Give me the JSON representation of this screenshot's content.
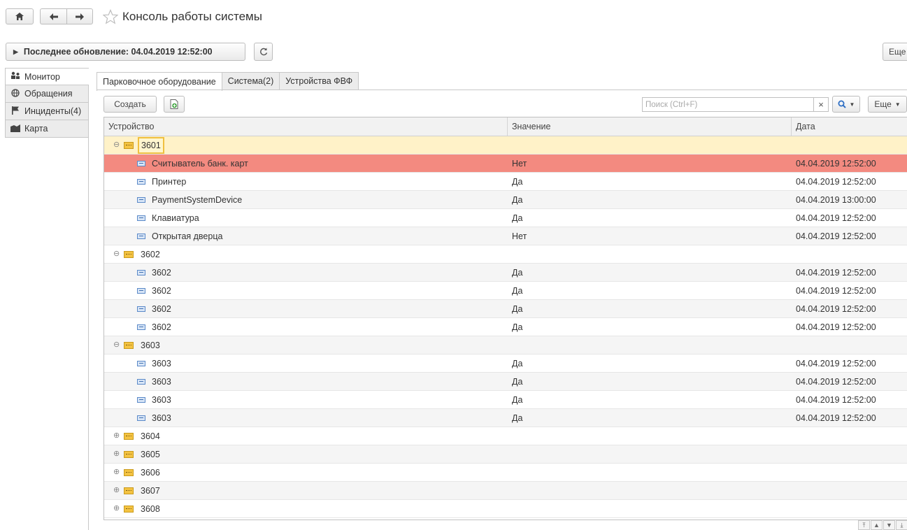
{
  "header": {
    "title": "Консоль работы системы",
    "home_icon": "home-icon",
    "back_icon": "arrow-left-icon",
    "forward_icon": "arrow-right-icon",
    "star_icon": "star-outline-icon"
  },
  "toolbar": {
    "update_label": "Последнее обновление: 04.04.2019 12:52:00",
    "refresh_icon": "refresh-icon",
    "more_label": "Еще"
  },
  "sidebar": {
    "items": [
      {
        "label": "Монитор",
        "icon": "monitor-icon"
      },
      {
        "label": "Обращения",
        "icon": "globe-icon"
      },
      {
        "label": "Инциденты(4)",
        "icon": "flag-icon"
      },
      {
        "label": "Карта",
        "icon": "map-icon"
      }
    ]
  },
  "tabs": [
    "Парковочное оборудование",
    "Система(2)",
    "Устройства ФВФ"
  ],
  "list_toolbar": {
    "create_label": "Создать",
    "add_icon": "add-document-icon",
    "search_placeholder": "Поиск (Ctrl+F)",
    "clear_label": "×",
    "search_icon": "search-icon",
    "more_label": "Еще"
  },
  "grid": {
    "columns": [
      "Устройство",
      "Значение",
      "Дата"
    ],
    "rows": [
      {
        "type": "group",
        "name": "3601",
        "expanded": true,
        "state": "selected"
      },
      {
        "type": "device",
        "name": "Считыватель банк. карт",
        "value": "Нет",
        "date": "04.04.2019 12:52:00",
        "state": "error"
      },
      {
        "type": "device",
        "name": "Принтер",
        "value": "Да",
        "date": "04.04.2019 12:52:00"
      },
      {
        "type": "device",
        "name": "PaymentSystemDevice",
        "value": "Да",
        "date": "04.04.2019 13:00:00"
      },
      {
        "type": "device",
        "name": "Клавиатура",
        "value": "Да",
        "date": "04.04.2019 12:52:00"
      },
      {
        "type": "device",
        "name": "Открытая дверца",
        "value": "Нет",
        "date": "04.04.2019 12:52:00"
      },
      {
        "type": "group",
        "name": "3602",
        "expanded": true
      },
      {
        "type": "device",
        "name": "3602",
        "value": "Да",
        "date": "04.04.2019 12:52:00"
      },
      {
        "type": "device",
        "name": "3602",
        "value": "Да",
        "date": "04.04.2019 12:52:00"
      },
      {
        "type": "device",
        "name": "3602",
        "value": "Да",
        "date": "04.04.2019 12:52:00"
      },
      {
        "type": "device",
        "name": "3602",
        "value": "Да",
        "date": "04.04.2019 12:52:00"
      },
      {
        "type": "group",
        "name": "3603",
        "expanded": true
      },
      {
        "type": "device",
        "name": "3603",
        "value": "Да",
        "date": "04.04.2019 12:52:00"
      },
      {
        "type": "device",
        "name": "3603",
        "value": "Да",
        "date": "04.04.2019 12:52:00"
      },
      {
        "type": "device",
        "name": "3603",
        "value": "Да",
        "date": "04.04.2019 12:52:00"
      },
      {
        "type": "device",
        "name": "3603",
        "value": "Да",
        "date": "04.04.2019 12:52:00"
      },
      {
        "type": "group",
        "name": "3604",
        "expanded": false
      },
      {
        "type": "group",
        "name": "3605",
        "expanded": false
      },
      {
        "type": "group",
        "name": "3606",
        "expanded": false
      },
      {
        "type": "group",
        "name": "3607",
        "expanded": false
      },
      {
        "type": "group",
        "name": "3608",
        "expanded": false
      }
    ]
  },
  "colors": {
    "error_row": "#f38a80",
    "selected_row": "#fff2c8",
    "folder": "#f4c342"
  }
}
